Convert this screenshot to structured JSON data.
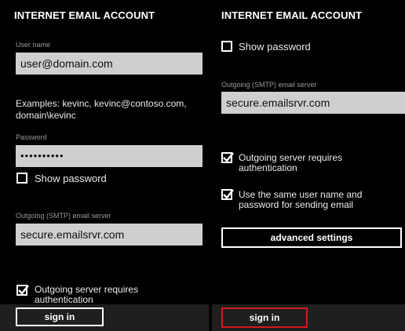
{
  "left": {
    "title": "INTERNET EMAIL ACCOUNT",
    "username_label": "User name",
    "username_value": "user@domain.com",
    "examples": "Examples: kevinc, kevinc@contoso.com, domain\\kevinc",
    "password_label": "Password",
    "password_value": "••••••••••",
    "show_password_label": "Show password",
    "show_password_checked": false,
    "smtp_label": "Outgoing (SMTP) email server",
    "smtp_value": "secure.emailsrvr.com",
    "auth_label": "Outgoing server requires authentication",
    "auth_checked": true,
    "sign_in_label": "sign in"
  },
  "right": {
    "title": "INTERNET EMAIL ACCOUNT",
    "show_password_label": "Show password",
    "show_password_checked": false,
    "smtp_label": "Outgoing (SMTP) email server",
    "smtp_value": "secure.emailsrvr.com",
    "auth_label": "Outgoing server requires authentication",
    "auth_checked": true,
    "same_credentials_label": "Use the same user name and password for sending email",
    "same_credentials_checked": true,
    "advanced_label": "advanced settings",
    "sign_in_label": "sign in",
    "sign_in_highlight_color": "#d21a1a"
  }
}
